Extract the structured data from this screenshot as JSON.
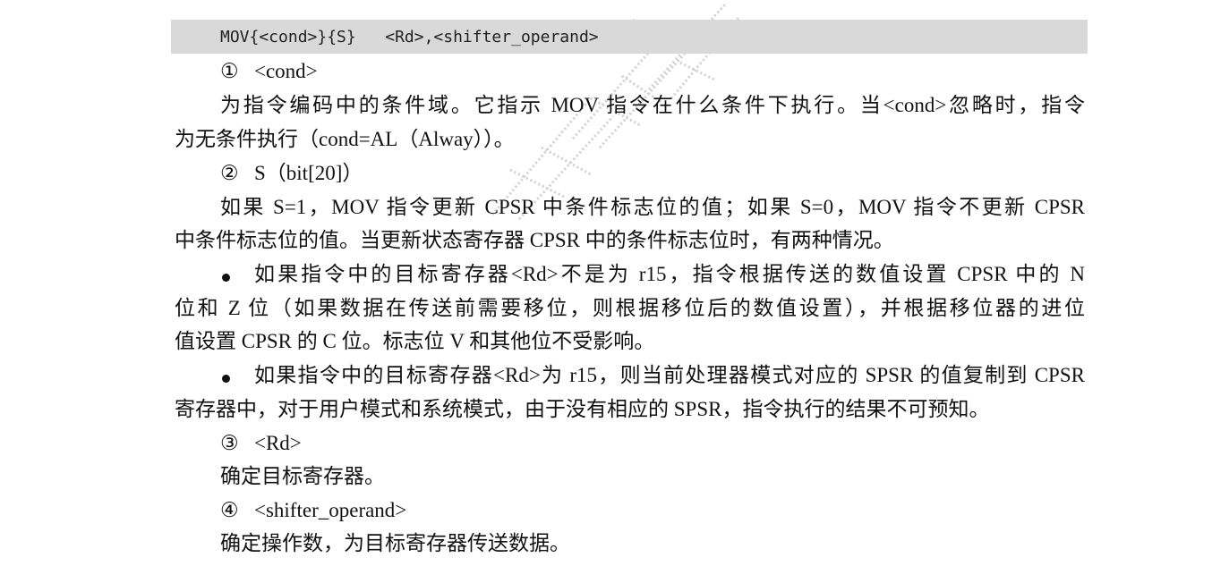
{
  "code": {
    "syntax": "MOV{<cond>}{S}   <Rd>,<shifter_operand>"
  },
  "lines": {
    "l1_num": "①",
    "l1_text": "<cond>",
    "l2": "为指令编码中的条件域。它指示 MOV 指令在什么条件下执行。当<cond>忽略时，指令",
    "l3": "为无条件执行（cond=AL（Alway））。",
    "l4_num": "②",
    "l4_text": "S（bit[20]）",
    "l5": "如果 S=1，MOV 指令更新 CPSR 中条件标志位的值；如果 S=0，MOV 指令不更新 CPSR",
    "l6": "中条件标志位的值。当更新状态寄存器 CPSR 中的条件标志位时，有两种情况。",
    "l7": "如果指令中的目标寄存器<Rd>不是为 r15，指令根据传送的数值设置 CPSR 中的 N",
    "l8": "位和 Z 位（如果数据在传送前需要移位，则根据移位后的数值设置），并根据移位器的进位",
    "l9": "值设置 CPSR 的 C 位。标志位 V 和其他位不受影响。",
    "l10": "如果指令中的目标寄存器<Rd>为 r15，则当前处理器模式对应的 SPSR 的值复制到 CPSR",
    "l11": "寄存器中，对于用户模式和系统模式，由于没有相应的 SPSR，指令执行的结果不可预知。",
    "l12_num": "③",
    "l12_text": "<Rd>",
    "l13": "确定目标寄存器。",
    "l14_num": "④",
    "l14_text": "<shifter_operand>",
    "l15": "确定操作数，为目标寄存器传送数据。"
  }
}
